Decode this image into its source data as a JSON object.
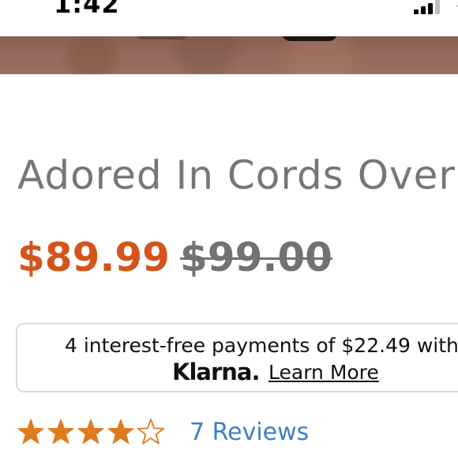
{
  "status_bar": {
    "time": "1:42",
    "signal_bars": 4,
    "signal_bars_filled": 3
  },
  "product": {
    "title": "Adored In Cords Overalls",
    "sale_price": "$89.99",
    "original_price": "$99.00"
  },
  "klarna": {
    "installment_text": "4 interest-free payments of $22.49 with",
    "logo_text": "Klarna.",
    "learn_more_label": "Learn More"
  },
  "rating": {
    "value": 4,
    "max": 5,
    "reviews_label": "7 Reviews",
    "star_color": "#e07a1f"
  },
  "colors": {
    "sale_price": "#d4541b",
    "original_price": "#727272",
    "title": "#767676",
    "reviews_link": "#3c7fc4"
  }
}
